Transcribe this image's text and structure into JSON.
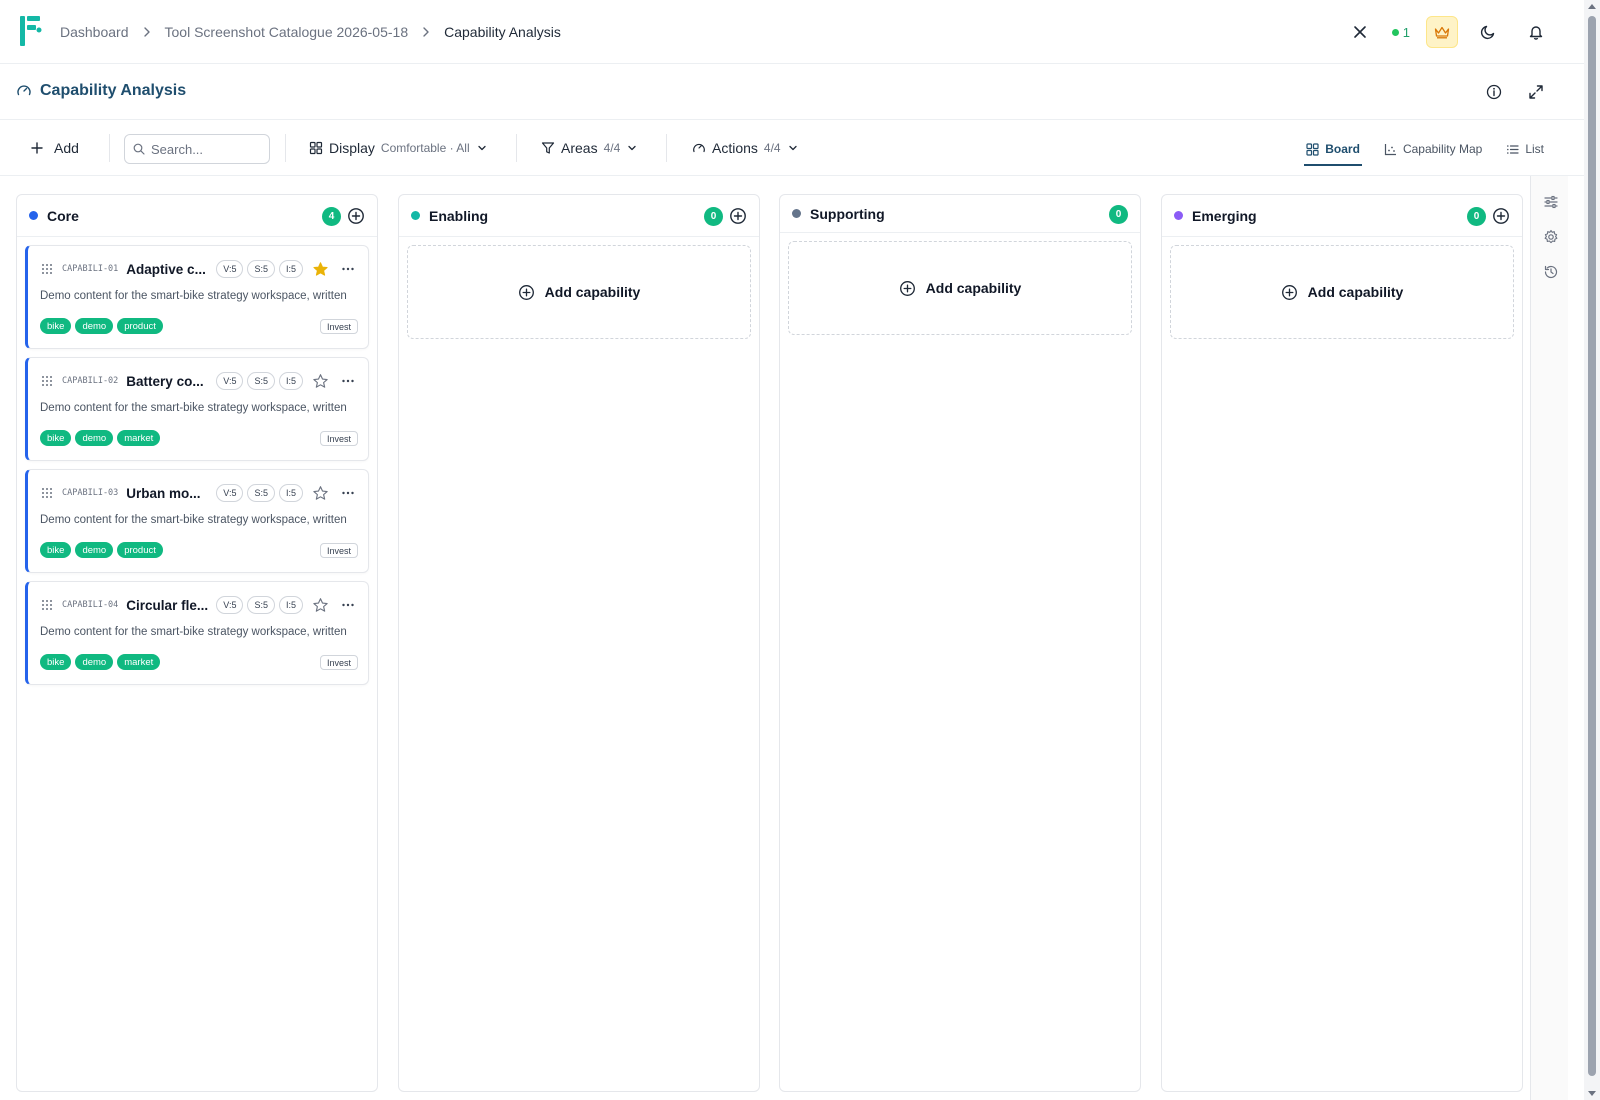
{
  "breadcrumb": {
    "items": [
      "Dashboard",
      "Tool Screenshot Catalogue 2026-05-18",
      "Capability Analysis"
    ]
  },
  "header": {
    "online_count": "1"
  },
  "page": {
    "title": "Capability Analysis"
  },
  "toolbar": {
    "add_label": "Add",
    "search_placeholder": "Search...",
    "display_label": "Display",
    "display_sub": "Comfortable · All",
    "areas_label": "Areas",
    "areas_sub": "4/4",
    "actions_label": "Actions",
    "actions_sub": "4/4",
    "views": [
      "Board",
      "Capability Map",
      "List"
    ],
    "active_view": "Board"
  },
  "columns": [
    {
      "name": "Core",
      "color": "#2563eb",
      "count": "4",
      "cards": [
        {
          "code": "CAPABILI-01",
          "title": "Adaptive c...",
          "v": "V:5",
          "s": "S:5",
          "i": "I:5",
          "starred": true,
          "description": "Demo content for the smart-bike strategy workspace, written to make the tool state visible in catalogue screenshots.",
          "tags": [
            "bike",
            "demo",
            "product"
          ],
          "action": "Invest"
        },
        {
          "code": "CAPABILI-02",
          "title": "Battery co...",
          "v": "V:5",
          "s": "S:5",
          "i": "I:5",
          "starred": false,
          "description": "Demo content for the smart-bike strategy workspace, written to make the tool state visible in catalogue screenshots.",
          "tags": [
            "bike",
            "demo",
            "market"
          ],
          "action": "Invest"
        },
        {
          "code": "CAPABILI-03",
          "title": "Urban mo...",
          "v": "V:5",
          "s": "S:5",
          "i": "I:5",
          "starred": false,
          "description": "Demo content for the smart-bike strategy workspace, written to make the tool state visible in catalogue screenshots.",
          "tags": [
            "bike",
            "demo",
            "product"
          ],
          "action": "Invest"
        },
        {
          "code": "CAPABILI-04",
          "title": "Circular fle...",
          "v": "V:5",
          "s": "S:5",
          "i": "I:5",
          "starred": false,
          "description": "Demo content for the smart-bike strategy workspace, written to make the tool state visible in catalogue screenshots.",
          "tags": [
            "bike",
            "demo",
            "market"
          ],
          "action": "Invest"
        }
      ]
    },
    {
      "name": "Enabling",
      "color": "#14b8a6",
      "count": "0",
      "add_label": "Add capability",
      "cards": []
    },
    {
      "name": "Supporting",
      "color": "#64748b",
      "count": "0",
      "add_label": "Add capability",
      "cards": []
    },
    {
      "name": "Emerging",
      "color": "#8b5cf6",
      "count": "0",
      "add_label": "Add capability",
      "cards": []
    }
  ],
  "colors": {
    "accent": "#1f4e6e",
    "count_badge": "#10b981",
    "tag": "#10b981",
    "star": "#eab308"
  }
}
